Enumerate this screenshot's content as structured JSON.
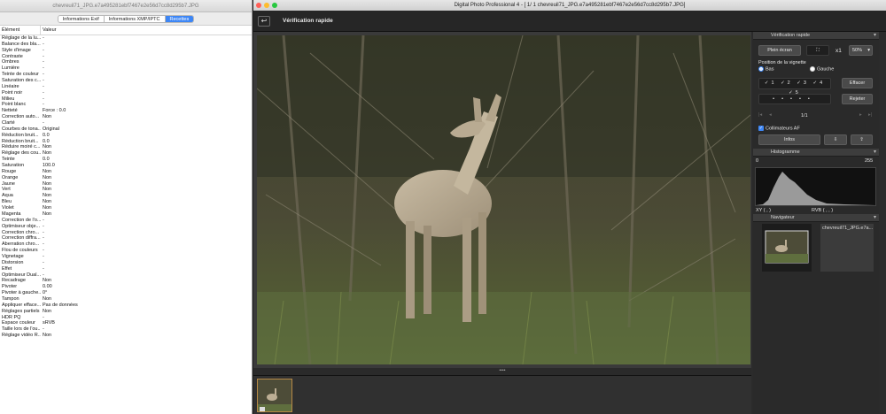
{
  "left_window": {
    "title": "chevreuil71_JPG.e7a495281ebf7467e2e56d7cc8d295b7.JPG",
    "tabs": [
      {
        "label": "Informations Exif",
        "active": false
      },
      {
        "label": "Informations XMP/IPTC",
        "active": false
      },
      {
        "label": "Recettes",
        "active": true
      }
    ],
    "columns": {
      "element": "Élément",
      "value": "Valeur"
    },
    "rows": [
      {
        "k": "Réglage de la lu...",
        "v": "-"
      },
      {
        "k": "Balance des bla...",
        "v": "-"
      },
      {
        "k": "Style d'image",
        "v": "-"
      },
      {
        "k": "Contraste",
        "v": "-"
      },
      {
        "k": "Ombres",
        "v": "-"
      },
      {
        "k": "Lumière",
        "v": "-"
      },
      {
        "k": "Teinte de couleur",
        "v": "-"
      },
      {
        "k": "Saturation des c...",
        "v": "-"
      },
      {
        "k": "Linéaire",
        "v": "-"
      },
      {
        "k": "Point noir",
        "v": "-"
      },
      {
        "k": "Milieu",
        "v": "-"
      },
      {
        "k": "Point blanc",
        "v": "-"
      },
      {
        "k": "Netteté",
        "v": "Force : 0.0"
      },
      {
        "k": "Correction auto...",
        "v": "Non"
      },
      {
        "k": "Clarté",
        "v": "-"
      },
      {
        "k": "Courbes de tona...",
        "v": "Original"
      },
      {
        "k": "Réduction bruit...",
        "v": "0.0"
      },
      {
        "k": "Réduction bruit...",
        "v": "0.0"
      },
      {
        "k": "Réduire moiré c...",
        "v": "Non"
      },
      {
        "k": "Réglage des cou...",
        "v": "Non"
      },
      {
        "k": "Teinte",
        "v": "0.0"
      },
      {
        "k": "Saturation",
        "v": "100.0"
      },
      {
        "k": "Rouge",
        "v": "Non"
      },
      {
        "k": "Orange",
        "v": "Non"
      },
      {
        "k": "Jaune",
        "v": "Non"
      },
      {
        "k": "Vert",
        "v": "Non"
      },
      {
        "k": "Aqua",
        "v": "Non"
      },
      {
        "k": "Bleu",
        "v": "Non"
      },
      {
        "k": "Violet",
        "v": "Non"
      },
      {
        "k": "Magenta",
        "v": "Non"
      },
      {
        "k": "Correction de l'o...",
        "v": "-"
      },
      {
        "k": "Optimiseur obje...",
        "v": "-"
      },
      {
        "k": "Correction chro...",
        "v": "-"
      },
      {
        "k": "Correction diffra...",
        "v": "-"
      },
      {
        "k": "Aberration chro...",
        "v": "-"
      },
      {
        "k": "Flou de couleurs",
        "v": "-"
      },
      {
        "k": "Vignetage",
        "v": "-"
      },
      {
        "k": "Distorsion",
        "v": "-"
      },
      {
        "k": "Effet",
        "v": "-"
      },
      {
        "k": "Optimiseur Dual...",
        "v": "-"
      },
      {
        "k": "Recadrage",
        "v": "Non"
      },
      {
        "k": "Pivoter",
        "v": "0.00"
      },
      {
        "k": "Pivoter à gauche...",
        "v": "0°"
      },
      {
        "k": "Tampon",
        "v": "Non"
      },
      {
        "k": "Appliquer efface...",
        "v": "Pas de données"
      },
      {
        "k": "Réglages partiels",
        "v": "Non"
      },
      {
        "k": "HDR PQ",
        "v": "-"
      },
      {
        "k": "Espace couleur",
        "v": "sRVB"
      },
      {
        "k": "Taille lors de l'ou...",
        "v": "-"
      },
      {
        "k": "Réglage vidéo R...",
        "v": "Non"
      }
    ]
  },
  "main_window": {
    "title": "Digital Photo Professional 4 - [   1/   1 chevreuil71_JPG.e7a495281ebf7467e2e56d7cc8d295b7.JPG]",
    "view_title": "Vérification rapide",
    "panel": {
      "quick_check_header": "Vérification rapide",
      "fullscreen_label": "Plein écran",
      "zoom_x1": "x1",
      "zoom_pct": "50%",
      "thumb_pos_label": "Position de la vignette",
      "radio_bottom": "Bas",
      "radio_left": "Gauche",
      "ratings": [
        "1",
        "2",
        "3",
        "4",
        "5"
      ],
      "clear_label": "Effacer",
      "reject_label": "Rejeter",
      "page_counter": "1/1",
      "af_points_label": "Collimateurs AF",
      "info_label": "Infos",
      "histogram_header": "Histogramme",
      "hist_min": "0",
      "hist_max": "255",
      "xy_label": "XY (        ,        )",
      "rgb_label": "RVB (        ,        ,        )",
      "navigator_header": "Navigateur",
      "navigator_filename": "chevreuil71_JPG.e7a..."
    }
  }
}
